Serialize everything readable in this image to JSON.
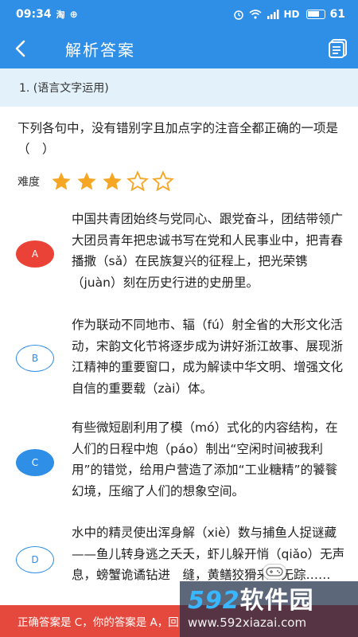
{
  "status": {
    "time": "09:34",
    "app_icons": [
      "淘",
      "⊕"
    ],
    "network": "HD",
    "battery": "61"
  },
  "nav": {
    "title": "解析答案"
  },
  "question_header": "1. (语言文字运用)",
  "question": "下列各句中，没有错别字且加点字的注音全都正确的一项是（　）",
  "difficulty": {
    "label": "难度",
    "rating": 3,
    "max": 5,
    "filled_color": "#f5a623",
    "empty_color": "#f5a623"
  },
  "options": [
    {
      "letter": "A",
      "state": "wrong",
      "text": "中国共青团始终与党同心、跟党奋斗，团结带领广大团员青年把忠诚书写在党和人民事业中，把青春播撒（sǎ）在民族复兴的征程上，把光荣镌（juàn）刻在历史行进的史册里。"
    },
    {
      "letter": "B",
      "state": "plain",
      "text": "作为联动不同地市、辐（fú）射全省的大形文化活动，宋韵文化节将逐步成为讲好浙江故事、展现浙江精神的重要窗口，成为解读中华文明、增强文化自信的重要载（zài）体。"
    },
    {
      "letter": "C",
      "state": "correct",
      "text": "有些微短剧利用了模（mó）式化的内容结构，在人们的日程中炮（páo）制出“空闲时间被我利用”的错觉，给用户营造了添加“工业糖精”的饕餮幻境，压缩了人们的想象空间。"
    },
    {
      "letter": "D",
      "state": "plain",
      "text": "水中的精灵使出浑身解（xiè）数与捕鱼人捉谜藏——鱼儿转身逃之夭夭，虾儿躲开悄（qiǎo）无声息，螃蟹诡谲钻进　缝，黄鳝狡猾来去无踪……"
    }
  ],
  "bottom_bar": "正确答案是 C，你的答案是 A，回",
  "watermark": {
    "logo_num": "592",
    "logo_txt": "软件园",
    "url": "www.592xiazai.com"
  },
  "colors": {
    "primary": "#2f8fe6",
    "wrong": "#ea4236",
    "header_bg": "#e3f1fb",
    "bottom_bar": "#e5483c"
  }
}
